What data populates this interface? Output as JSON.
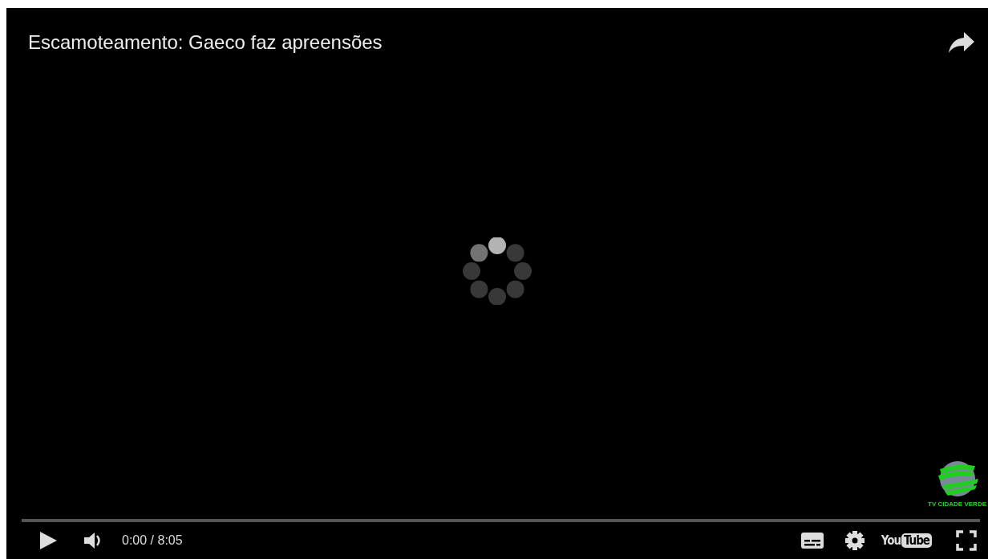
{
  "video": {
    "title": "Escamoteamento: Gaeco faz apreensões",
    "channel_logo": {
      "caption": "TV CIDADE VERDE"
    }
  },
  "progress": {
    "level": 0
  },
  "controls": {
    "time": "0:00 / 8:05",
    "youtube_logo": {
      "you": "You",
      "tube": "Tube"
    }
  }
}
